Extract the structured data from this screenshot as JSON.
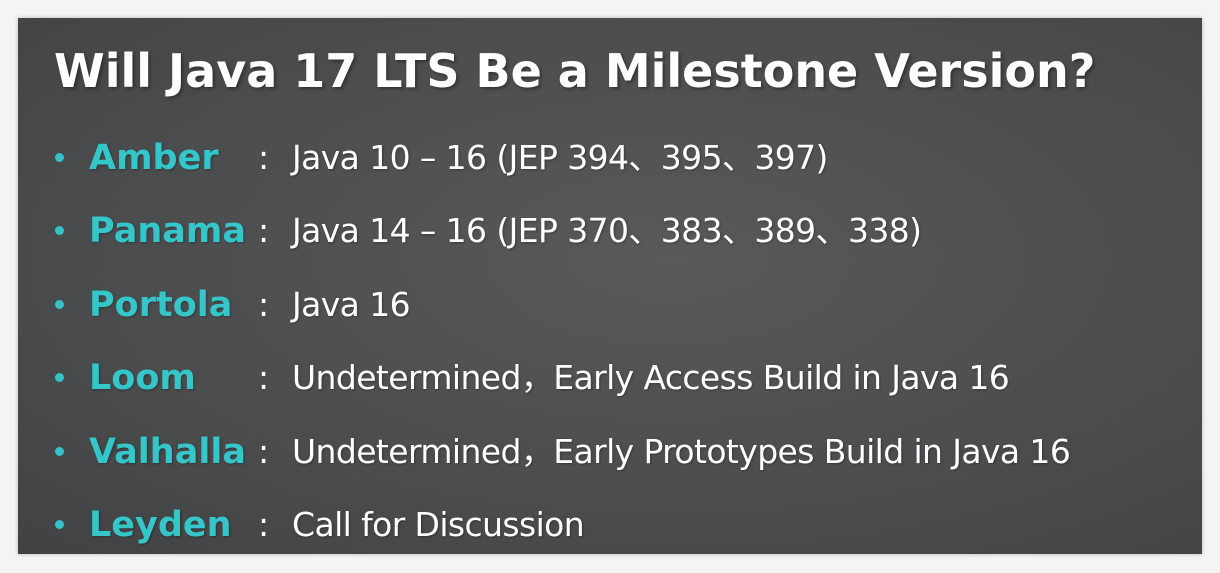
{
  "slide": {
    "title": "Will Java 17 LTS Be a Milestone Version?",
    "items": [
      {
        "name": "Amber",
        "separator": ":",
        "description": "Java 10 – 16   (JEP 394、395、397)"
      },
      {
        "name": "Panama",
        "separator": ":",
        "description": "Java 14 – 16  (JEP 370、383、389、338)"
      },
      {
        "name": "Portola",
        "separator": ":",
        "description": "Java 16"
      },
      {
        "name": "Loom",
        "separator": ":",
        "description": "Undetermined，Early Access Build in Java 16"
      },
      {
        "name": "Valhalla",
        "separator": ":",
        "description": "Undetermined，Early Prototypes Build in Java 16"
      },
      {
        "name": "Leyden",
        "separator": ":",
        "description": "Call for Discussion"
      }
    ]
  },
  "colors": {
    "background": "#4b4d4f",
    "accent": "#35c6c9",
    "text": "#ffffff"
  }
}
